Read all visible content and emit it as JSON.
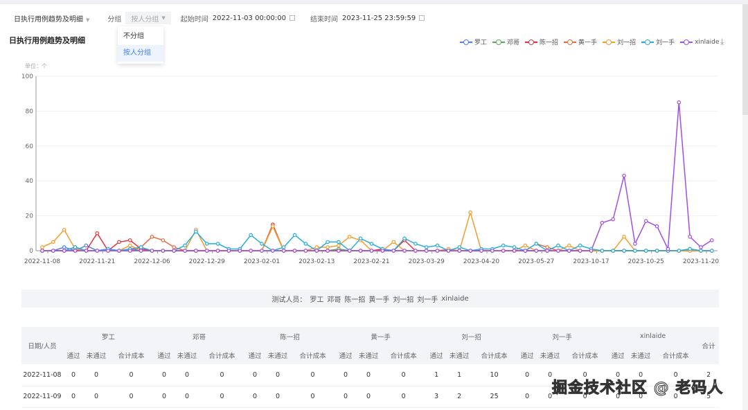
{
  "filters": {
    "report": "日执行用例趋势及明细",
    "group_label": "分组",
    "group_value": "按人分组",
    "start_label": "起始时间",
    "start_value": "2022-11-03 00:00:00",
    "end_label": "结束时间",
    "end_value": "2023-11-25 23:59:59"
  },
  "dropdown": {
    "options": [
      "不分组",
      "按人分组"
    ],
    "selected": "按人分组"
  },
  "section_title": "日执行用例趋势及明细",
  "download_icon": "download-icon",
  "chart_data": {
    "type": "line",
    "unit_label": "单位：个",
    "ylim": [
      0,
      100
    ],
    "y_ticks": [
      0,
      20,
      40,
      60,
      80,
      100
    ],
    "grid": true,
    "legend_position": "top-right",
    "x_tick_labels": [
      {
        "index": 0,
        "label": "2022-11-08"
      },
      {
        "index": 5,
        "label": "2022-11-21"
      },
      {
        "index": 10,
        "label": "2022-12-06"
      },
      {
        "index": 15,
        "label": "2022-12-29"
      },
      {
        "index": 20,
        "label": "2023-02-01"
      },
      {
        "index": 25,
        "label": "2023-02-13"
      },
      {
        "index": 30,
        "label": "2023-02-21"
      },
      {
        "index": 35,
        "label": "2023-03-29"
      },
      {
        "index": 40,
        "label": "2023-04-20"
      },
      {
        "index": 45,
        "label": "2023-05-27"
      },
      {
        "index": 50,
        "label": "2023-10-17"
      },
      {
        "index": 55,
        "label": "2023-10-25"
      },
      {
        "index": 60,
        "label": "2023-11-20"
      }
    ],
    "series": [
      {
        "name": "罗工",
        "color": "#4e7cf5",
        "values": [
          0,
          0,
          2,
          0,
          3,
          0,
          1,
          0,
          1,
          0,
          0,
          0,
          0,
          0,
          0,
          0,
          0,
          0,
          0,
          0,
          0,
          0,
          0,
          0,
          0,
          0,
          0,
          0,
          0,
          0,
          0,
          0,
          0,
          0,
          0,
          0,
          0,
          0,
          0,
          0,
          0,
          0,
          0,
          0,
          0,
          0,
          0,
          0,
          0,
          0,
          0,
          0,
          0,
          0,
          0,
          0,
          0,
          0,
          0,
          0,
          0,
          0
        ]
      },
      {
        "name": "邓哥",
        "color": "#4caf50",
        "values": [
          0,
          0,
          0,
          2,
          0,
          0,
          0,
          0,
          0,
          0,
          0,
          0,
          0,
          0,
          0,
          0,
          0,
          0,
          0,
          0,
          0,
          0,
          0,
          0,
          0,
          0,
          0,
          1,
          0,
          0,
          0,
          0,
          0,
          0,
          0,
          0,
          0,
          0,
          0,
          0,
          0,
          0,
          0,
          0,
          0,
          0,
          0,
          0,
          0,
          0,
          0,
          0,
          0,
          0,
          0,
          0,
          0,
          0,
          0,
          1,
          0,
          0
        ]
      },
      {
        "name": "陈一招",
        "color": "#e8313b",
        "values": [
          0,
          0,
          0,
          0,
          0,
          10,
          0,
          5,
          6,
          1,
          0,
          0,
          0,
          0,
          0,
          0,
          0,
          0,
          0,
          0,
          0,
          15,
          0,
          0,
          0,
          0,
          0,
          0,
          0,
          0,
          0,
          1,
          0,
          6,
          0,
          0,
          0,
          0,
          0,
          0,
          0,
          0,
          0,
          0,
          0,
          0,
          0,
          0,
          0,
          0,
          0,
          0,
          0,
          0,
          0,
          0,
          0,
          0,
          0,
          0,
          0,
          0
        ]
      },
      {
        "name": "黄一手",
        "color": "#f0643c",
        "values": [
          0,
          0,
          0,
          0,
          0,
          0,
          0,
          0,
          0,
          2,
          8,
          6,
          2,
          0,
          0,
          0,
          0,
          0,
          0,
          0,
          0,
          14,
          0,
          0,
          0,
          0,
          0,
          0,
          0,
          0,
          0,
          0,
          0,
          0,
          0,
          0,
          0,
          0,
          0,
          0,
          0,
          0,
          0,
          0,
          0,
          4,
          2,
          0,
          0,
          0,
          0,
          0,
          0,
          0,
          0,
          0,
          0,
          0,
          0,
          0,
          0,
          0
        ]
      },
      {
        "name": "刘一招",
        "color": "#f59c27",
        "values": [
          2,
          5,
          12,
          1,
          0,
          0,
          0,
          0,
          3,
          0,
          0,
          0,
          0,
          0,
          12,
          0,
          0,
          0,
          0,
          0,
          0,
          14,
          0,
          0,
          0,
          2,
          2,
          3,
          8,
          6,
          0,
          0,
          5,
          0,
          0,
          0,
          0,
          1,
          0,
          22,
          0,
          0,
          0,
          0,
          3,
          0,
          0,
          0,
          3,
          0,
          0,
          0,
          0,
          8,
          0,
          0,
          0,
          0,
          0,
          0,
          0,
          0
        ]
      },
      {
        "name": "刘一手",
        "color": "#22aee0",
        "values": [
          0,
          0,
          0,
          2,
          0,
          0,
          1,
          0,
          1,
          2,
          0,
          0,
          0,
          3,
          11,
          4,
          4,
          1,
          1,
          9,
          4,
          0,
          2,
          9,
          4,
          0,
          5,
          5,
          0,
          7,
          4,
          1,
          0,
          7,
          4,
          2,
          3,
          0,
          2,
          0,
          1,
          1,
          3,
          2,
          0,
          4,
          0,
          3,
          0,
          3,
          1,
          0,
          0,
          0,
          0,
          0,
          0,
          0,
          0,
          1,
          0,
          0
        ]
      },
      {
        "name": "xinlaide",
        "color": "#a24de8",
        "values": [
          0,
          0,
          0,
          0,
          0,
          0,
          0,
          0,
          0,
          0,
          0,
          0,
          0,
          0,
          0,
          0,
          0,
          0,
          0,
          0,
          0,
          0,
          0,
          0,
          0,
          0,
          0,
          0,
          0,
          0,
          0,
          0,
          0,
          0,
          0,
          0,
          0,
          0,
          0,
          0,
          0,
          0,
          0,
          0,
          0,
          0,
          0,
          0,
          0,
          0,
          0,
          16,
          18,
          43,
          4,
          17,
          14,
          1,
          85,
          8,
          2,
          6
        ]
      }
    ]
  },
  "testers": {
    "label": "测试人员：",
    "names": [
      "罗工",
      "邓哥",
      "陈一招",
      "黄一手",
      "刘一招",
      "刘一手",
      "xinlaide"
    ]
  },
  "table": {
    "date_header": "日期/人员",
    "total_header": "合计",
    "groups": [
      "罗工",
      "邓哥",
      "陈一招",
      "黄一手",
      "刘一招",
      "刘一手",
      "xinlaide"
    ],
    "sub_headers": [
      "通过",
      "未通过",
      "合计成本"
    ],
    "rows": [
      {
        "date": "2022-11-08",
        "cells": [
          "0",
          "0",
          "0",
          "0",
          "0",
          "0",
          "0",
          "0",
          "0",
          "0",
          "0",
          "0",
          "1",
          "1",
          "10",
          "0",
          "0",
          "0",
          "0",
          "0",
          "0"
        ],
        "total": "2"
      },
      {
        "date": "2022-11-09",
        "cells": [
          "0",
          "0",
          "0",
          "0",
          "0",
          "0",
          "0",
          "0",
          "0",
          "0",
          "0",
          "0",
          "3",
          "2",
          "25",
          "0",
          "0",
          "0",
          "0",
          "0",
          "0"
        ],
        "total": "5"
      }
    ]
  },
  "watermark": "掘金技术社区 @ 老码人"
}
